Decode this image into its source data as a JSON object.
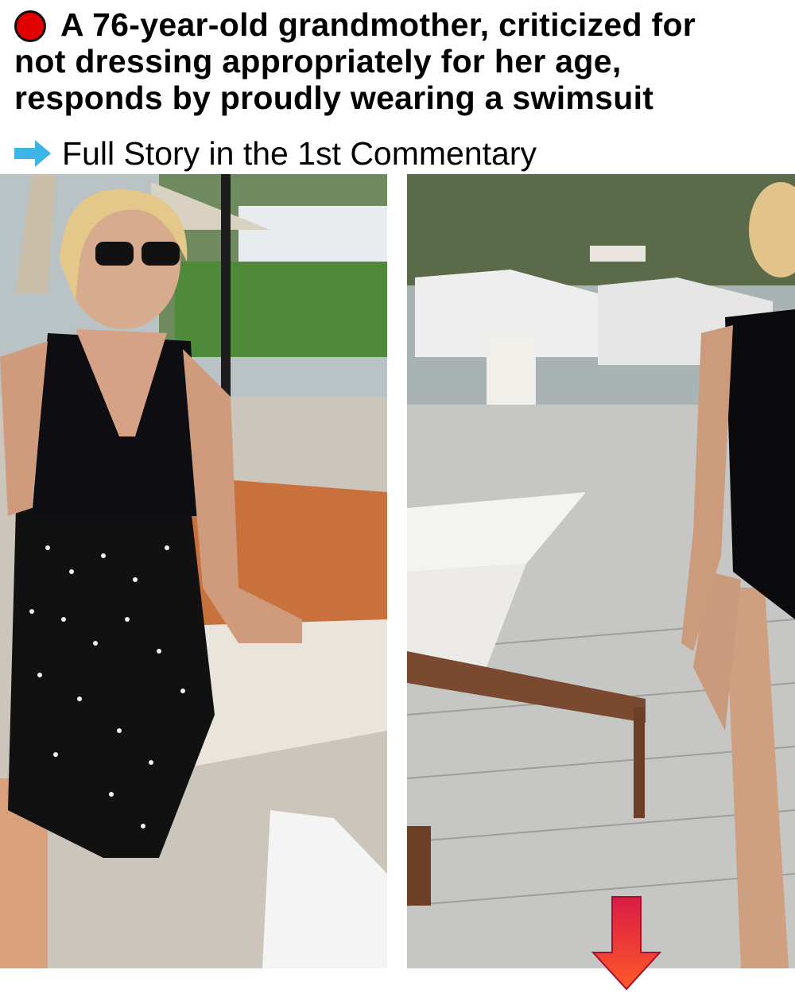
{
  "headline": {
    "lines": [
      "A 76-year-old grandmother, criticized for",
      "not dressing appropriately for her age,",
      "responds by proudly wearing a swimsuit"
    ],
    "bullet_icon": "red-circle-icon",
    "bullet_color": "#e00000"
  },
  "subline": {
    "icon": "right-arrow-icon",
    "icon_color": "#3cb4e6",
    "text": "Full Story in the 1st Commentary"
  },
  "photos": {
    "left_subject": "woman-in-black-polka-dot-dress",
    "right_subject": "woman-in-black-swimsuit"
  },
  "pointer": {
    "icon": "down-arrow-icon",
    "color": "#e8294c"
  }
}
